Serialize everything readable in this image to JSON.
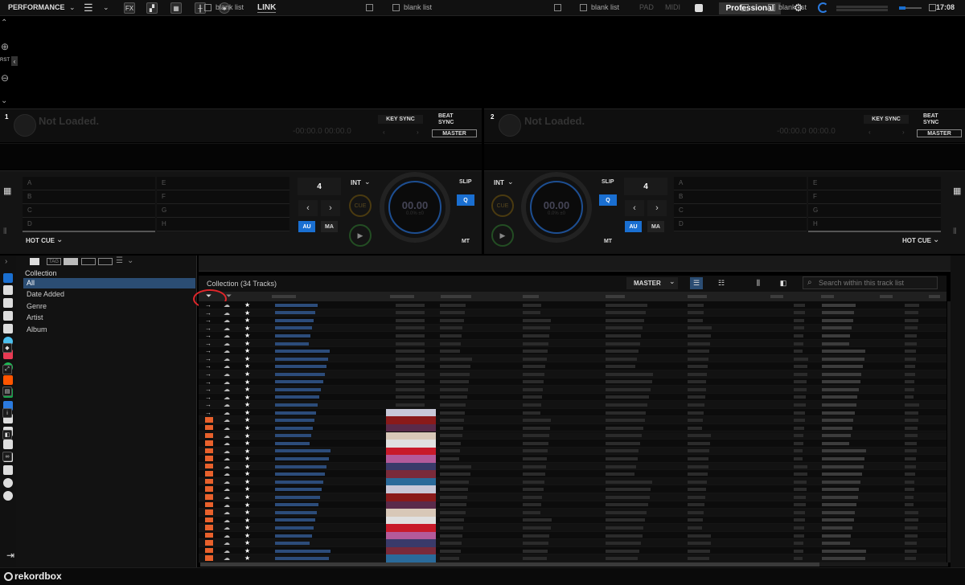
{
  "topbar": {
    "mode": "PERFORMANCE",
    "fx": "FX",
    "link": "LINK",
    "pad": "PAD",
    "midi": "MIDI",
    "plan": "Professional",
    "clock": "17:08"
  },
  "waveform": {
    "reset": "RST"
  },
  "decks": [
    {
      "num": "1",
      "title": "Not Loaded.",
      "time": "-00:00.0  00:00.0",
      "key_sync": "KEY SYNC",
      "beat_sync": "BEAT\nSYNC",
      "master": "MASTER",
      "bpm": "00.00",
      "pitch": "0.0% ±0",
      "loop_beats": "4",
      "int": "INT",
      "slip": "SLIP",
      "q": "Q",
      "au": "AU",
      "ma": "MA",
      "mt": "MT",
      "cue": "CUE",
      "hot_cue_label": "HOT CUE",
      "hot_cues": [
        "A",
        "B",
        "C",
        "D",
        "E",
        "F",
        "G",
        "H"
      ]
    },
    {
      "num": "2",
      "title": "Not Loaded.",
      "time": "-00:00.0  00:00.0",
      "key_sync": "KEY SYNC",
      "beat_sync": "BEAT\nSYNC",
      "master": "MASTER",
      "bpm": "00.00",
      "pitch": "0.0% ±0",
      "loop_beats": "4",
      "int": "INT",
      "slip": "SLIP",
      "q": "Q",
      "au": "AU",
      "ma": "MA",
      "mt": "MT",
      "cue": "CUE",
      "hot_cue_label": "HOT CUE",
      "hot_cues": [
        "A",
        "B",
        "C",
        "D",
        "E",
        "F",
        "G",
        "H"
      ]
    }
  ],
  "browser": {
    "tag": "TAG",
    "tree": {
      "root": "Collection",
      "items": [
        "All",
        "Date Added",
        "Genre",
        "Artist",
        "Album"
      ],
      "selected": "All"
    },
    "playlist_tabs": [
      "blank list",
      "blank list",
      "blank list",
      "blank list"
    ],
    "collection_title": "Collection (34 Tracks)",
    "master_select": "MASTER",
    "search_placeholder": "Search within this track list",
    "row_count": 34
  },
  "footer": {
    "brand": "rekordbox"
  },
  "colors": {
    "accent": "#1a6fd1",
    "orange": "#e8612c",
    "highlight_ring": "#e0262a"
  }
}
